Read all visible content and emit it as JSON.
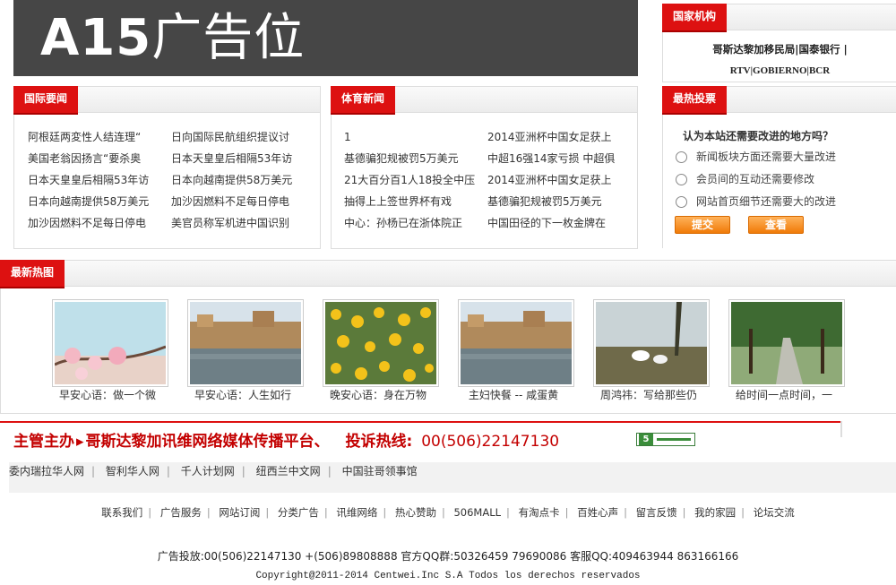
{
  "ad": {
    "latin": "A15",
    "cn": "广告位"
  },
  "intl_news": {
    "title": "国际要闻",
    "left": [
      "阿根廷两変性人结连理“",
      "美国老翁因扬言“要杀奥",
      "日本天皇皇后相隔53年访",
      "日本向越南提供58万美元",
      "加沙因燃料不足每日停电"
    ],
    "right": [
      "日向国际民航组织提议讨",
      "日本天皇皇后相隔53年访",
      "日本向越南提供58万美元",
      "加沙因燃料不足每日停电",
      "美官员称军机进中国识别"
    ]
  },
  "sports_news": {
    "title": "体育新闻",
    "left": [
      "1",
      "基德骗犯规被罚5万美元",
      "21大百分百1人18投全中压",
      "抽得上上签世界杯有戏",
      "中心：孙杨已在浙体院正"
    ],
    "right": [
      "2014亚洲杯中国女足获上",
      "中超16强14家亏损 中超俱",
      "2014亚洲杯中国女足获上",
      "基德骗犯规被罚5万美元",
      "中国田径的下一枚金牌在"
    ]
  },
  "gov": {
    "title": "国家机构",
    "line1": "哥斯达黎加移民局|国泰银行 |",
    "line2": "RTV|GOBIERNO|BCR"
  },
  "poll": {
    "title": "最热投票",
    "question": "认为本站还需要改进的地方吗？",
    "options": [
      "新闻板块方面还需要大量改进",
      "会员间的互动还需要修改",
      "网站首页细节还需要大的改进"
    ],
    "submit": "提交",
    "view": "查看"
  },
  "photos": {
    "title": "最新热图",
    "captions": [
      "早安心语：做一个微",
      "早安心语：人生如行",
      "晚安心语：身在万物",
      "主妇快餐 -- 咸蛋黄",
      "周鸿祎：写给那些仍",
      "给时间一点时间，一"
    ]
  },
  "supervisor": {
    "prefix": "主管主办",
    "name": "哥斯达黎加讯维网络媒体传播平台、",
    "hotline_label": "投诉热线:",
    "hotline": "00(506)22147130",
    "badge": "5"
  },
  "friend_links": [
    "委内瑞拉华人网",
    "智利华人网",
    "千人计划网",
    "纽西兰中文网",
    "中国驻哥领事馆"
  ],
  "footer_links": [
    "联系我们",
    "广告服务",
    "网站订阅",
    "分类广告",
    "讯维网络",
    "热心赞助",
    "506MALL",
    "有淘点卡",
    "百姓心声",
    "留言反馈",
    "我的家园",
    "论坛交流"
  ],
  "contact": "广告投放:00(506)22147130 +(506)89808888 官方QQ群:50326459 79690086 客服QQ:409463944 863166166",
  "copyright": "Copyright@2011-2014 Centwei.Inc S.A Todos los derechos reservados"
}
